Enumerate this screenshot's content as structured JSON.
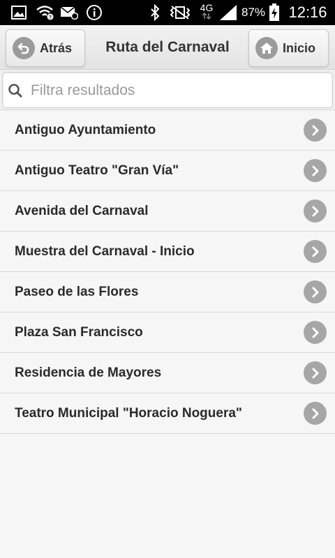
{
  "status_bar": {
    "battery": "87%",
    "network": "4G",
    "time": "12:16",
    "icons": [
      "image-icon",
      "wifi-question-icon",
      "email-icon",
      "info-icon",
      "bluetooth-icon",
      "vibrate-icon",
      "network-4g-icon",
      "signal-icon",
      "battery-charging-icon"
    ]
  },
  "header": {
    "back_label": "Atrás",
    "title": "Ruta del Carnaval",
    "home_label": "Inicio"
  },
  "search": {
    "placeholder": "Filtra resultados",
    "value": ""
  },
  "list": {
    "items": [
      "Antiguo Ayuntamiento",
      "Antiguo Teatro \"Gran Vía\"",
      "Avenida del Carnaval",
      "Muestra del Carnaval - Inicio",
      "Paseo de las Flores",
      "Plaza San Francisco",
      "Residencia de Mayores",
      "Teatro Municipal \"Horacio Noguera\""
    ]
  },
  "colors": {
    "background": "#f6f6f6",
    "status_bar": "#000000",
    "arrow_circle": "#a6a6a6",
    "text": "#2a2a2a"
  }
}
